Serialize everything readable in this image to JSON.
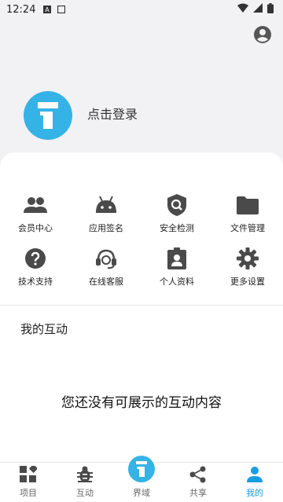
{
  "status_bar": {
    "time": "12:24",
    "a_icon": "A"
  },
  "header": {
    "login_label": "点击登录",
    "profile_icon": "account-circle-icon"
  },
  "grid": {
    "row1": [
      {
        "label": "会员中心",
        "icon": "members-icon"
      },
      {
        "label": "应用签名",
        "icon": "android-icon"
      },
      {
        "label": "安全检测",
        "icon": "security-scan-icon"
      },
      {
        "label": "文件管理",
        "icon": "folder-icon"
      }
    ],
    "row2": [
      {
        "label": "技术支持",
        "icon": "help-icon"
      },
      {
        "label": "在线客服",
        "icon": "headset-icon"
      },
      {
        "label": "个人资料",
        "icon": "profile-card-icon"
      },
      {
        "label": "更多设置",
        "icon": "gear-icon"
      }
    ]
  },
  "section": {
    "title": "我的互动",
    "empty_message": "您还没有可展示的互动内容"
  },
  "bottom_nav": [
    {
      "label": "项目",
      "icon": "apps-icon"
    },
    {
      "label": "互动",
      "icon": "bug-icon"
    },
    {
      "label": "界域",
      "icon": "info-icon"
    },
    {
      "label": "共享",
      "icon": "share-icon"
    },
    {
      "label": "我的",
      "icon": "person-icon",
      "active": true
    }
  ],
  "colors": {
    "accent": "#35b3e6",
    "active_nav": "#1a9ee3",
    "icon": "#4a4a4a"
  }
}
